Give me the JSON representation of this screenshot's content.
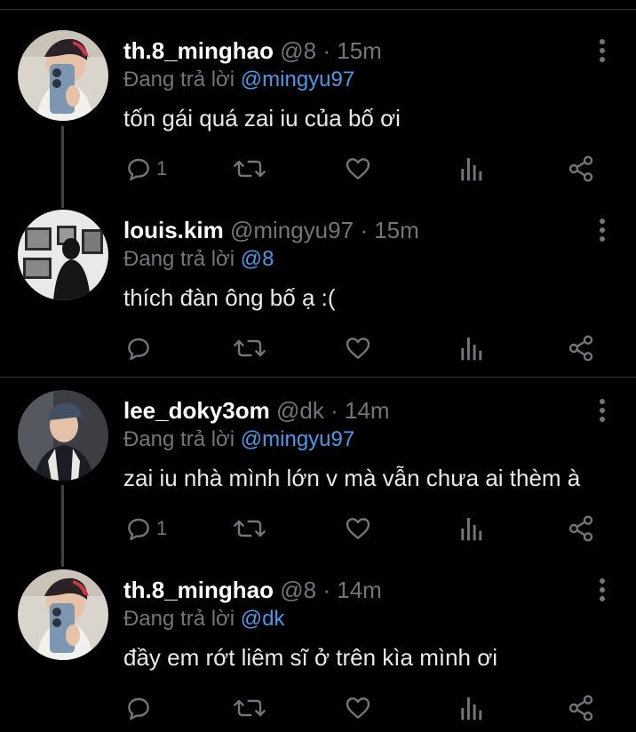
{
  "colors": {
    "background": "#000000",
    "text": "#e7e9ea",
    "muted": "#71767b",
    "mention": "#4a99e9",
    "divider": "#2f3336"
  },
  "tweets": [
    {
      "name": "th.8_minghao",
      "handle": "@8",
      "dot": "·",
      "time": "15m",
      "replying_label": "Đang trả lời",
      "replying_to": "@mingyu97",
      "text": "tốn gái quá zai iu của bố ơi",
      "reply_count": "1"
    },
    {
      "name": "louis.kim",
      "handle": "@mingyu97",
      "dot": "·",
      "time": "15m",
      "replying_label": "Đang trả lời",
      "replying_to": "@8",
      "text": "thích đàn ông bố ạ :(",
      "reply_count": ""
    },
    {
      "name": "lee_doky3om",
      "handle": "@dk",
      "dot": "·",
      "time": "14m",
      "replying_label": "Đang trả lời",
      "replying_to": "@mingyu97",
      "text": "zai iu nhà mình lớn v mà vẫn chưa ai thèm à",
      "reply_count": "1"
    },
    {
      "name": "th.8_minghao",
      "handle": "@8",
      "dot": "·",
      "time": "14m",
      "replying_label": "Đang trả lời",
      "replying_to": "@dk",
      "text": "đầy em rớt liêm sĩ ở trên kìa mình ơi",
      "reply_count": ""
    }
  ],
  "icons": {
    "reply": "reply-bubble-icon",
    "retweet": "retweet-icon",
    "like": "heart-icon",
    "views": "analytics-bars-icon",
    "share": "share-icon",
    "more": "more-vertical-icon"
  }
}
